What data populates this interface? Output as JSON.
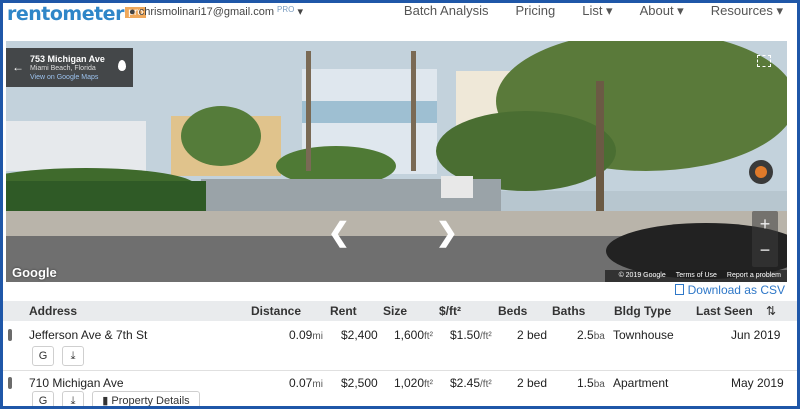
{
  "brand": {
    "logo_text": "rentometer",
    "pro_badge": "pro"
  },
  "user": {
    "email": "chrismolinari17@gmail.com",
    "tier": "PRO"
  },
  "nav": [
    "Batch Analysis",
    "Pricing",
    "List ▾",
    "About ▾",
    "Resources ▾"
  ],
  "street_view": {
    "address_line1": "753 Michigan Ave",
    "address_line2": "Miami Beach, Florida",
    "maps_link": "View on Google Maps",
    "provider": "Google",
    "copyright": "© 2019 Google",
    "terms": "Terms of Use",
    "report": "Report a problem"
  },
  "table": {
    "download": "Download as CSV",
    "headers": [
      "Address",
      "Distance",
      "Rent",
      "Size",
      "$/ft²",
      "Beds",
      "Baths",
      "Bldg Type",
      "Last Seen"
    ],
    "rows": [
      {
        "address": "Jefferson Ave & 7th St",
        "distance": "0.09",
        "distance_unit": "mi",
        "rent": "$2,400",
        "size": "1,600",
        "size_unit": "ft²",
        "ppsf": "$1.50",
        "ppsf_unit": "/ft²",
        "beds": "2 bed",
        "baths": "2.5",
        "baths_unit": "ba",
        "type": "Townhouse",
        "last_seen": "Jun 2019",
        "buttons": [
          "G",
          "⤓"
        ]
      },
      {
        "address": "710 Michigan Ave",
        "distance": "0.07",
        "distance_unit": "mi",
        "rent": "$2,500",
        "size": "1,020",
        "size_unit": "ft²",
        "ppsf": "$2.45",
        "ppsf_unit": "/ft²",
        "beds": "2 bed",
        "baths": "1.5",
        "baths_unit": "ba",
        "type": "Apartment",
        "last_seen": "May 2019",
        "buttons": [
          "G",
          "⤓",
          "Property Details"
        ]
      }
    ]
  }
}
